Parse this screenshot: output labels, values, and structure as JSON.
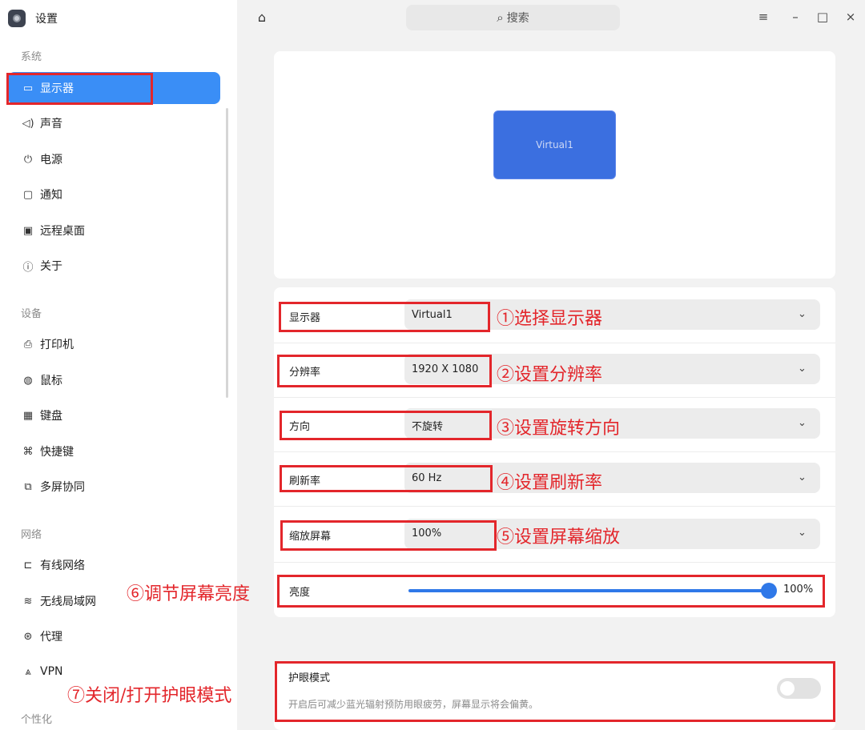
{
  "app": {
    "title": "设置"
  },
  "search": {
    "placeholder": "搜索",
    "icon": "search-icon"
  },
  "window_controls": {
    "menu": "≡",
    "minimize": "–",
    "maximize": "□",
    "close": "×"
  },
  "sidebar": {
    "sections": [
      {
        "label": "系统",
        "items": [
          {
            "label": "显示器",
            "icon": "monitor-icon",
            "active": true
          },
          {
            "label": "声音",
            "icon": "speaker-icon"
          },
          {
            "label": "电源",
            "icon": "power-icon"
          },
          {
            "label": "通知",
            "icon": "chat-bubble-icon"
          },
          {
            "label": "远程桌面",
            "icon": "remote-desktop-icon"
          },
          {
            "label": "关于",
            "icon": "info-icon"
          }
        ]
      },
      {
        "label": "设备",
        "items": [
          {
            "label": "打印机",
            "icon": "printer-icon"
          },
          {
            "label": "鼠标",
            "icon": "mouse-icon"
          },
          {
            "label": "键盘",
            "icon": "keyboard-icon"
          },
          {
            "label": "快捷键",
            "icon": "shortcut-icon"
          },
          {
            "label": "多屏协同",
            "icon": "multi-screen-icon"
          }
        ]
      },
      {
        "label": "网络",
        "items": [
          {
            "label": "有线网络",
            "icon": "wired-network-icon"
          },
          {
            "label": "无线局域网",
            "icon": "wifi-icon"
          },
          {
            "label": "代理",
            "icon": "proxy-icon"
          },
          {
            "label": "VPN",
            "icon": "vpn-icon"
          }
        ]
      },
      {
        "label": "个性化",
        "items": []
      }
    ]
  },
  "display_preview": {
    "monitor_name": "Virtual1"
  },
  "settings": {
    "display": {
      "label": "显示器",
      "value": "Virtual1"
    },
    "resolution": {
      "label": "分辨率",
      "value": "1920 X 1080"
    },
    "orientation": {
      "label": "方向",
      "value": "不旋转"
    },
    "refresh_rate": {
      "label": "刷新率",
      "value": "60 Hz"
    },
    "scale": {
      "label": "缩放屏幕",
      "value": "100%"
    },
    "brightness": {
      "label": "亮度",
      "value": "100%",
      "level": 1.0
    }
  },
  "eye_protection": {
    "title": "护眼模式",
    "description": "开启后可减少蓝光辐射预防用眼疲劳，屏幕显示将会偏黄。",
    "enabled": false
  },
  "annotations": {
    "a1": "①选择显示器",
    "a2": "②设置分辨率",
    "a3": "③设置旋转方向",
    "a4": "④设置刷新率",
    "a5": "⑤设置屏幕缩放",
    "a6": "⑥调节屏幕亮度",
    "a7": "⑦关闭/打开护眼模式"
  },
  "colors": {
    "accent": "#3a8ef6",
    "annotation": "#e3262b",
    "preview_monitor": "#3b6fe0"
  }
}
